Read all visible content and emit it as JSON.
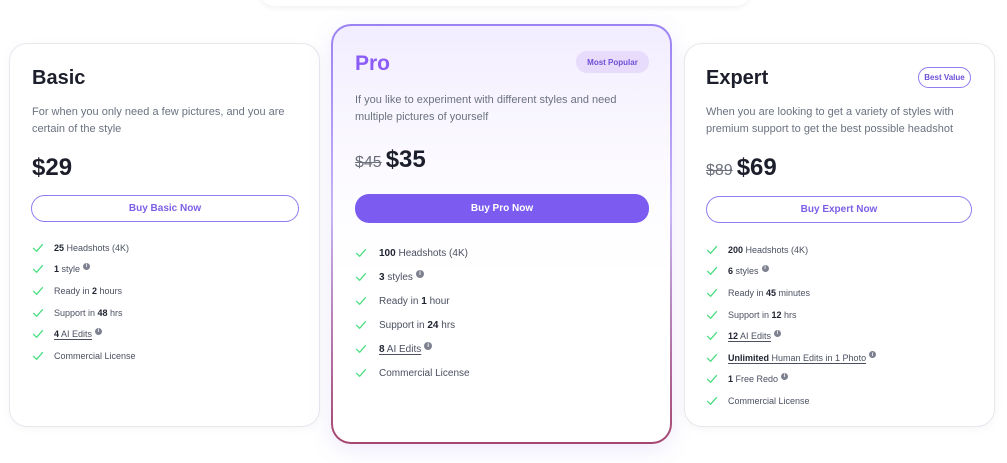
{
  "colors": {
    "accent": "#7c5cf0",
    "check": "#4ade80",
    "pro_title": "#8b5cf6"
  },
  "plans": {
    "basic": {
      "title": "Basic",
      "description": "For when you only need a few pictures, and you are certain of the style",
      "price": "$29",
      "button_label": "Buy Basic Now",
      "features": [
        {
          "bold": "25",
          "text": " Headshots (4K)",
          "info": false,
          "link": false
        },
        {
          "bold": "1",
          "text": " style",
          "info": true,
          "link": false
        },
        {
          "pre": "Ready in ",
          "bold": "2",
          "text": " hours",
          "info": false,
          "link": false
        },
        {
          "pre": "Support in ",
          "bold": "48",
          "text": " hrs",
          "info": false,
          "link": false
        },
        {
          "bold": "4",
          "text": " AI Edits",
          "info": true,
          "link": true
        },
        {
          "text": "Commercial License",
          "info": false,
          "link": false
        }
      ]
    },
    "pro": {
      "title": "Pro",
      "badge": "Most Popular",
      "description": "If you like to experiment with different styles and need multiple pictures of yourself",
      "old_price": "$45",
      "price": "$35",
      "button_label": "Buy Pro Now",
      "features": [
        {
          "bold": "100",
          "text": " Headshots (4K)",
          "info": false,
          "link": false
        },
        {
          "bold": "3",
          "text": " styles",
          "info": true,
          "link": false
        },
        {
          "pre": "Ready in ",
          "bold": "1",
          "text": " hour",
          "info": false,
          "link": false
        },
        {
          "pre": "Support in ",
          "bold": "24",
          "text": " hrs",
          "info": false,
          "link": false
        },
        {
          "bold": "8",
          "text": " AI Edits",
          "info": true,
          "link": true
        },
        {
          "text": "Commercial License",
          "info": false,
          "link": false
        }
      ]
    },
    "expert": {
      "title": "Expert",
      "badge": "Best Value",
      "description": "When you are looking to get a variety of styles with premium support to get the best possible headshot",
      "old_price": "$89",
      "price": "$69",
      "button_label": "Buy Expert Now",
      "features": [
        {
          "bold": "200",
          "text": " Headshots (4K)",
          "info": false,
          "link": false
        },
        {
          "bold": "6",
          "text": " styles",
          "info": true,
          "link": false
        },
        {
          "pre": "Ready in ",
          "bold": "45",
          "text": " minutes",
          "info": false,
          "link": false
        },
        {
          "pre": "Support in ",
          "bold": "12",
          "text": " hrs",
          "info": false,
          "link": false
        },
        {
          "bold": "12",
          "text": " AI Edits",
          "info": true,
          "link": true
        },
        {
          "bold": "Unlimited",
          "text": " Human Edits in 1 Photo",
          "info": true,
          "link": true
        },
        {
          "bold": "1",
          "text": " Free Redo",
          "info": true,
          "link": false
        },
        {
          "text": "Commercial License",
          "info": false,
          "link": false
        }
      ]
    }
  }
}
